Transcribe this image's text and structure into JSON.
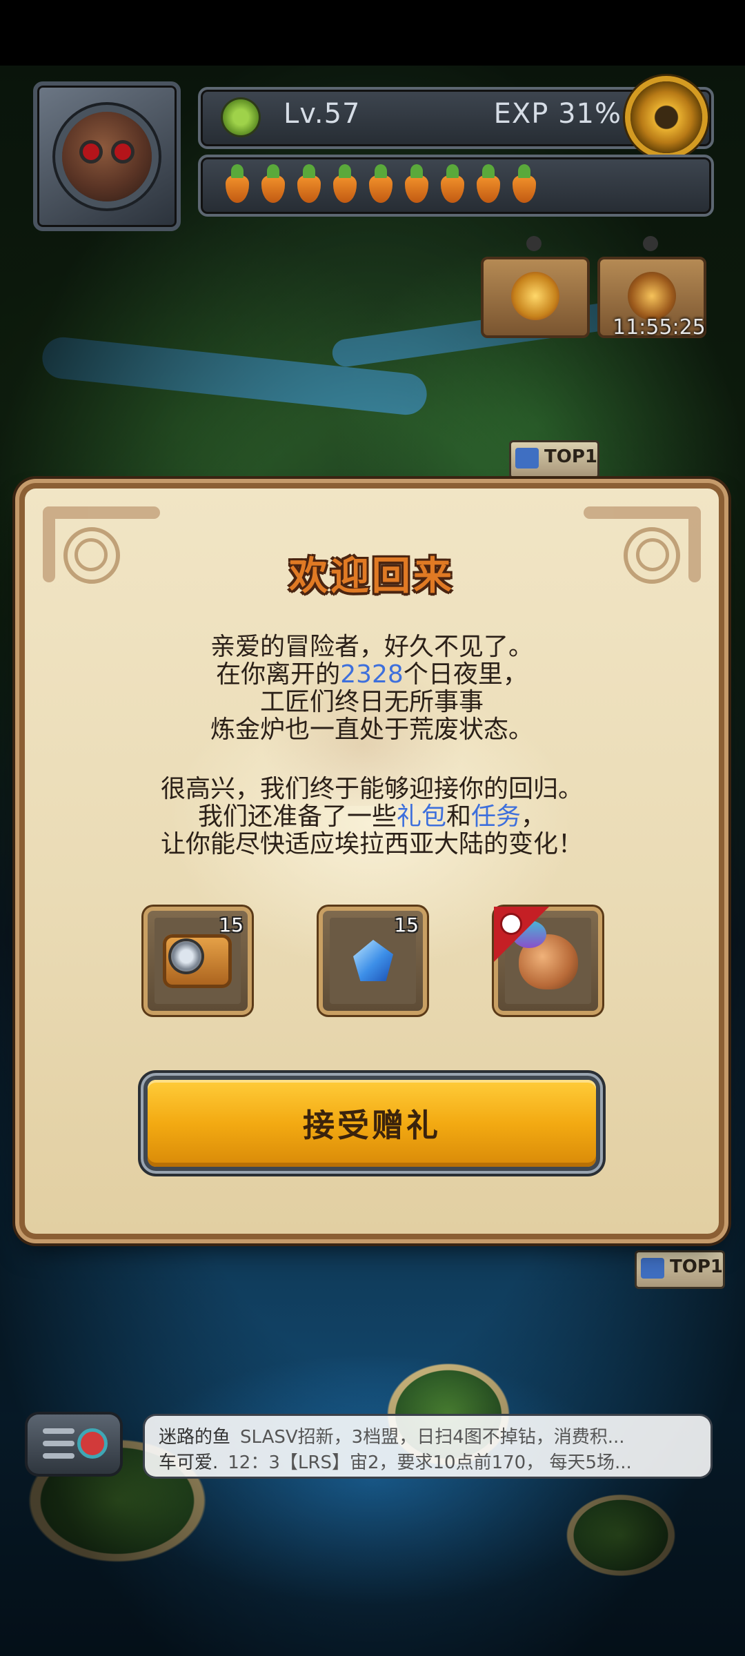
{
  "hud": {
    "level": "Lv.57",
    "exp": "EXP 31%",
    "carrot_count": 9,
    "timer": "11:55:25",
    "top_badge": "TOP1"
  },
  "dialog": {
    "title": "欢迎回来",
    "para1_line1": "亲爱的冒险者，好久不见了。",
    "para1_line2_pre": "在你离开的",
    "para1_days": "2328",
    "para1_line2_post": "个日夜里，",
    "para1_line3": "工匠们终日无所事事",
    "para1_line4": "炼金炉也一直处于荒废状态。",
    "para2_line1": "很高兴，我们终于能够迎接你的回归。",
    "para2_line2_pre": "我们还准备了一些",
    "para2_gift": "礼包",
    "para2_and": "和",
    "para2_task": "任务",
    "para2_line2_post": "，",
    "para2_line3": "让你能尽快适应埃拉西亚大陆的变化！",
    "rewards": [
      {
        "icon": "camera-icon",
        "count": "15"
      },
      {
        "icon": "crystal-icon",
        "count": "15"
      },
      {
        "icon": "creature-icon",
        "count": ""
      }
    ],
    "accept_label": "接受赠礼",
    "highlight_color": "#3d6fdc"
  },
  "chat": {
    "line1_name": "迷路的鱼",
    "line1_msg": "SLASV招新，3档盟，日扫4图不掉钻，消费积...",
    "line2_name": "车可爱.",
    "line2_msg": "12：3【LRS】宙2，要求10点前170， 每天5场..."
  }
}
